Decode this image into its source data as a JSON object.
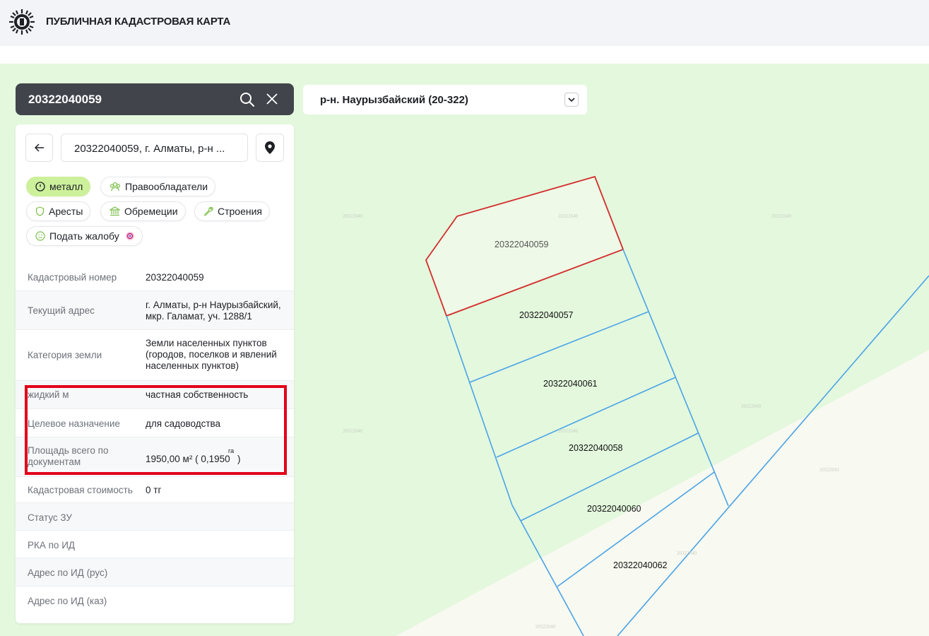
{
  "header": {
    "title": "ПУБЛИЧНАЯ КАДАСТРОВАЯ КАРТА"
  },
  "search": {
    "value": "20322040059"
  },
  "district": {
    "label": "р-н. Наурызбайский (20-322)"
  },
  "panel": {
    "address_short": "20322040059, г. Алматы, р-н ...",
    "chips": {
      "metal": "металл",
      "owners": "Правообладатели",
      "arrests": "Аресты",
      "encumbrances": "Обремеции",
      "buildings": "Строения",
      "complaint": "Подать жалобу"
    },
    "rows": [
      {
        "label": "Кадастровый номер",
        "value": "20322040059"
      },
      {
        "label": "Текущий адрес",
        "value": "г. Алматы, р-н Наурызбайский, мкр. Галамат, уч. 1288/1"
      },
      {
        "label": "Категория земли",
        "value": "Земли населенных пунктов (городов, поселков и явлений населенных пунктов)"
      },
      {
        "label": "жидкий м",
        "value": "частная собственность"
      },
      {
        "label": "Целевое назначение",
        "value": "для садоводства"
      },
      {
        "label": "Площадь всего по документам",
        "value": "1950,00 м² ( 0,1950",
        "value_sup": "га",
        "value_tail": ")"
      },
      {
        "label": "Кадастровая стоимость",
        "value": "0 тг"
      },
      {
        "label": "Статус ЗУ",
        "value": ""
      },
      {
        "label": "РКА по ИД",
        "value": ""
      },
      {
        "label": "Адрес по ИД (рус)",
        "value": ""
      },
      {
        "label": "Адрес по ИД (каз)",
        "value": ""
      }
    ]
  },
  "map": {
    "parcels": [
      "20322040059",
      "20322040057",
      "20322040061",
      "20322040058",
      "20322040060",
      "20322040062"
    ],
    "faint_labels": [
      "20322040",
      "20322040",
      "20322040",
      "20322040",
      "20322040",
      "20322040",
      "20322041",
      "20322040",
      "20322040"
    ]
  },
  "colors": {
    "selected_outline": "#d42b2b",
    "parcel_outline": "#4aa3e8",
    "highlight": "#e3001b",
    "accent": "#cdf09b"
  }
}
